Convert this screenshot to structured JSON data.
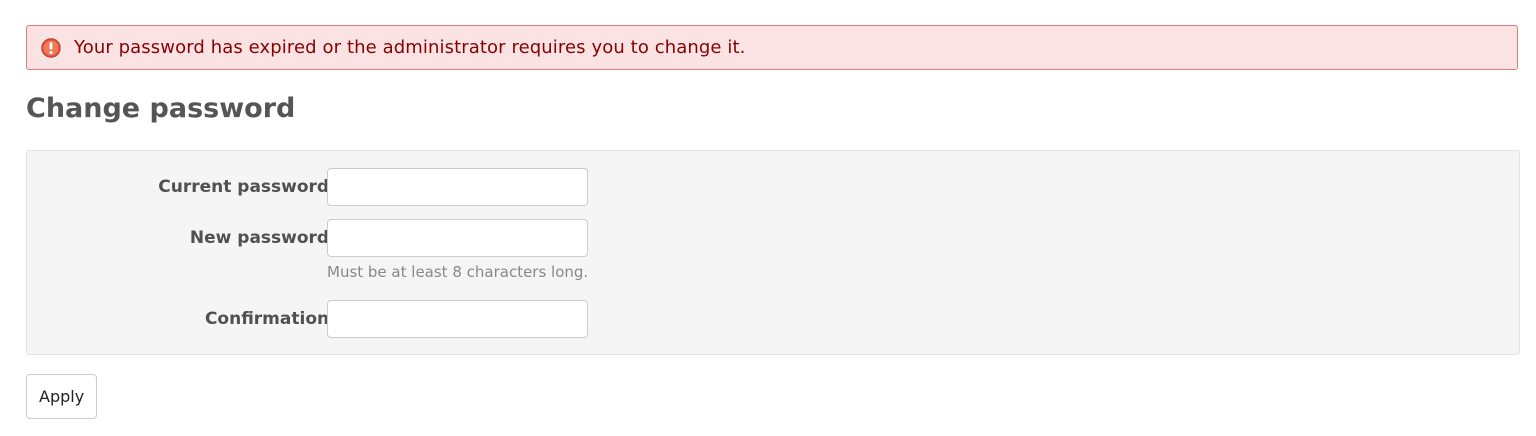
{
  "flash": {
    "message": "Your password has expired or the administrator requires you to change it.",
    "icon": "exclamation-circle-icon",
    "background_color": "#fbe3e4",
    "border_color": "#e07d7d",
    "text_color": "#880000"
  },
  "page": {
    "title": "Change password"
  },
  "form": {
    "current_password": {
      "label": "Current password",
      "required_marker": "*",
      "value": ""
    },
    "new_password": {
      "label": "New password",
      "required_marker": "*",
      "value": "",
      "hint": "Must be at least 8 characters long."
    },
    "confirmation": {
      "label": "Confirmation",
      "required_marker": "*",
      "value": ""
    },
    "submit_label": "Apply"
  }
}
